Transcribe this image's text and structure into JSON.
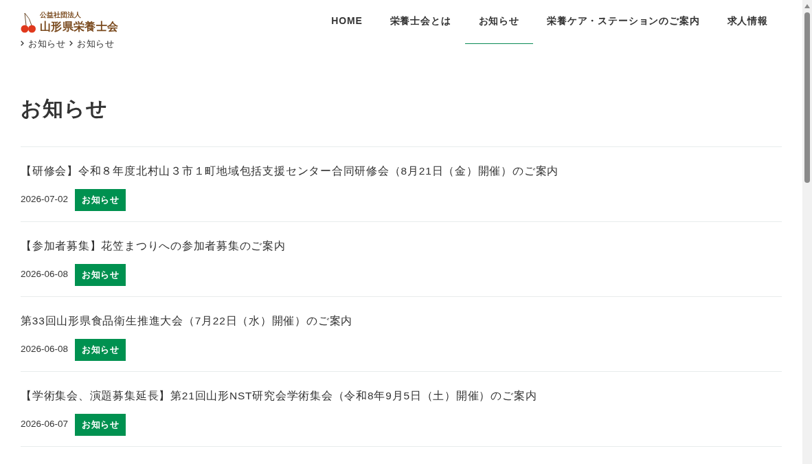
{
  "logo": {
    "subtitle": "公益社団法人",
    "name": "山形県栄養士会"
  },
  "nav": [
    {
      "label": "HOME",
      "selected": false
    },
    {
      "label": "栄養士会とは",
      "selected": false
    },
    {
      "label": "お知らせ",
      "selected": true
    },
    {
      "label": "栄養ケア・ステーションのご案内",
      "selected": false
    },
    {
      "label": "求人情報",
      "selected": false
    }
  ],
  "breadcrumb": [
    "お知らせ",
    "お知らせ"
  ],
  "page_title": "お知らせ",
  "posts": [
    {
      "title": "【研修会】令和８年度北村山３市１町地域包括支援センター合同研修会（8月21日（金）開催）のご案内",
      "date": "2026-07-02",
      "category": "お知らせ"
    },
    {
      "title": "【参加者募集】花笠まつりへの参加者募集のご案内",
      "date": "2026-06-08",
      "category": "お知らせ"
    },
    {
      "title": "第33回山形県食品衛生推進大会（7月22日（水）開催）のご案内",
      "date": "2026-06-08",
      "category": "お知らせ"
    },
    {
      "title": "【学術集会、演題募集延長】第21回山形NST研究会学術集会（令和8年9月5日（土）開催）のご案内",
      "date": "2026-06-07",
      "category": "お知らせ"
    }
  ]
}
